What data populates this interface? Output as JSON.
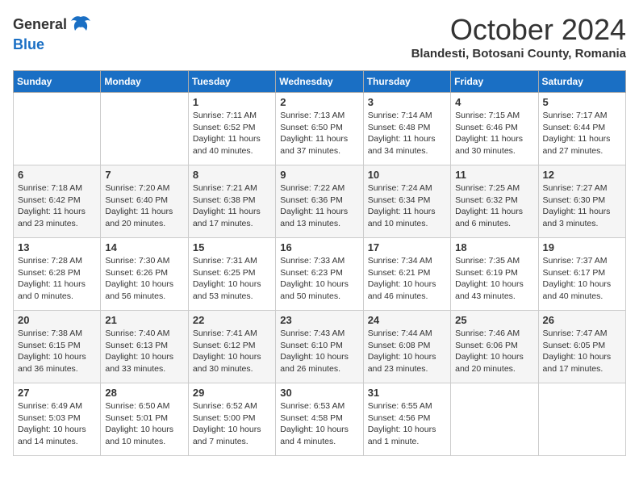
{
  "logo": {
    "general": "General",
    "blue": "Blue"
  },
  "title": "October 2024",
  "subtitle": "Blandesti, Botosani County, Romania",
  "days": [
    "Sunday",
    "Monday",
    "Tuesday",
    "Wednesday",
    "Thursday",
    "Friday",
    "Saturday"
  ],
  "weeks": [
    [
      {
        "day": "",
        "content": ""
      },
      {
        "day": "",
        "content": ""
      },
      {
        "day": "1",
        "content": "Sunrise: 7:11 AM\nSunset: 6:52 PM\nDaylight: 11 hours and 40 minutes."
      },
      {
        "day": "2",
        "content": "Sunrise: 7:13 AM\nSunset: 6:50 PM\nDaylight: 11 hours and 37 minutes."
      },
      {
        "day": "3",
        "content": "Sunrise: 7:14 AM\nSunset: 6:48 PM\nDaylight: 11 hours and 34 minutes."
      },
      {
        "day": "4",
        "content": "Sunrise: 7:15 AM\nSunset: 6:46 PM\nDaylight: 11 hours and 30 minutes."
      },
      {
        "day": "5",
        "content": "Sunrise: 7:17 AM\nSunset: 6:44 PM\nDaylight: 11 hours and 27 minutes."
      }
    ],
    [
      {
        "day": "6",
        "content": "Sunrise: 7:18 AM\nSunset: 6:42 PM\nDaylight: 11 hours and 23 minutes."
      },
      {
        "day": "7",
        "content": "Sunrise: 7:20 AM\nSunset: 6:40 PM\nDaylight: 11 hours and 20 minutes."
      },
      {
        "day": "8",
        "content": "Sunrise: 7:21 AM\nSunset: 6:38 PM\nDaylight: 11 hours and 17 minutes."
      },
      {
        "day": "9",
        "content": "Sunrise: 7:22 AM\nSunset: 6:36 PM\nDaylight: 11 hours and 13 minutes."
      },
      {
        "day": "10",
        "content": "Sunrise: 7:24 AM\nSunset: 6:34 PM\nDaylight: 11 hours and 10 minutes."
      },
      {
        "day": "11",
        "content": "Sunrise: 7:25 AM\nSunset: 6:32 PM\nDaylight: 11 hours and 6 minutes."
      },
      {
        "day": "12",
        "content": "Sunrise: 7:27 AM\nSunset: 6:30 PM\nDaylight: 11 hours and 3 minutes."
      }
    ],
    [
      {
        "day": "13",
        "content": "Sunrise: 7:28 AM\nSunset: 6:28 PM\nDaylight: 11 hours and 0 minutes."
      },
      {
        "day": "14",
        "content": "Sunrise: 7:30 AM\nSunset: 6:26 PM\nDaylight: 10 hours and 56 minutes."
      },
      {
        "day": "15",
        "content": "Sunrise: 7:31 AM\nSunset: 6:25 PM\nDaylight: 10 hours and 53 minutes."
      },
      {
        "day": "16",
        "content": "Sunrise: 7:33 AM\nSunset: 6:23 PM\nDaylight: 10 hours and 50 minutes."
      },
      {
        "day": "17",
        "content": "Sunrise: 7:34 AM\nSunset: 6:21 PM\nDaylight: 10 hours and 46 minutes."
      },
      {
        "day": "18",
        "content": "Sunrise: 7:35 AM\nSunset: 6:19 PM\nDaylight: 10 hours and 43 minutes."
      },
      {
        "day": "19",
        "content": "Sunrise: 7:37 AM\nSunset: 6:17 PM\nDaylight: 10 hours and 40 minutes."
      }
    ],
    [
      {
        "day": "20",
        "content": "Sunrise: 7:38 AM\nSunset: 6:15 PM\nDaylight: 10 hours and 36 minutes."
      },
      {
        "day": "21",
        "content": "Sunrise: 7:40 AM\nSunset: 6:13 PM\nDaylight: 10 hours and 33 minutes."
      },
      {
        "day": "22",
        "content": "Sunrise: 7:41 AM\nSunset: 6:12 PM\nDaylight: 10 hours and 30 minutes."
      },
      {
        "day": "23",
        "content": "Sunrise: 7:43 AM\nSunset: 6:10 PM\nDaylight: 10 hours and 26 minutes."
      },
      {
        "day": "24",
        "content": "Sunrise: 7:44 AM\nSunset: 6:08 PM\nDaylight: 10 hours and 23 minutes."
      },
      {
        "day": "25",
        "content": "Sunrise: 7:46 AM\nSunset: 6:06 PM\nDaylight: 10 hours and 20 minutes."
      },
      {
        "day": "26",
        "content": "Sunrise: 7:47 AM\nSunset: 6:05 PM\nDaylight: 10 hours and 17 minutes."
      }
    ],
    [
      {
        "day": "27",
        "content": "Sunrise: 6:49 AM\nSunset: 5:03 PM\nDaylight: 10 hours and 14 minutes."
      },
      {
        "day": "28",
        "content": "Sunrise: 6:50 AM\nSunset: 5:01 PM\nDaylight: 10 hours and 10 minutes."
      },
      {
        "day": "29",
        "content": "Sunrise: 6:52 AM\nSunset: 5:00 PM\nDaylight: 10 hours and 7 minutes."
      },
      {
        "day": "30",
        "content": "Sunrise: 6:53 AM\nSunset: 4:58 PM\nDaylight: 10 hours and 4 minutes."
      },
      {
        "day": "31",
        "content": "Sunrise: 6:55 AM\nSunset: 4:56 PM\nDaylight: 10 hours and 1 minute."
      },
      {
        "day": "",
        "content": ""
      },
      {
        "day": "",
        "content": ""
      }
    ]
  ]
}
